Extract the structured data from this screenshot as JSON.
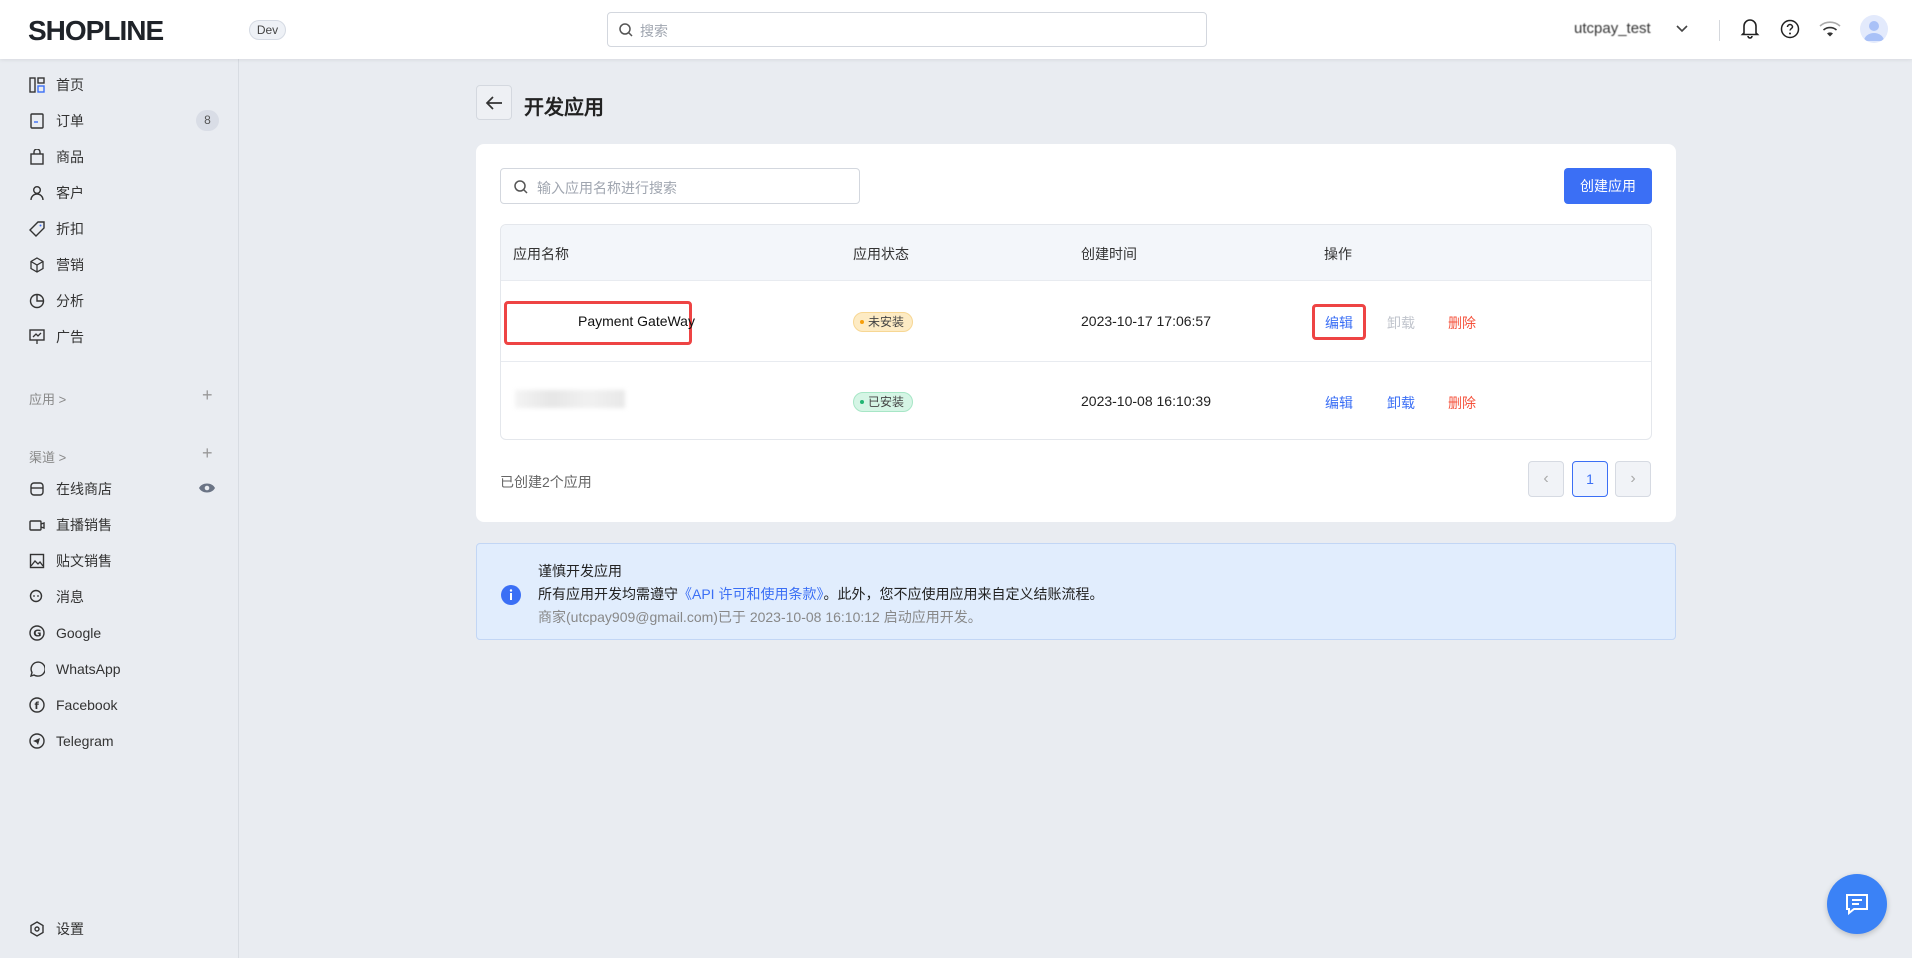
{
  "header": {
    "logo": "SHOPLINE",
    "env_badge": "Dev",
    "search_placeholder": "搜索",
    "username": "utcpay_test"
  },
  "sidebar": {
    "items": [
      {
        "label": "首页",
        "icon": "home-icon"
      },
      {
        "label": "订单",
        "icon": "order-icon",
        "badge": "8"
      },
      {
        "label": "商品",
        "icon": "bag-icon"
      },
      {
        "label": "客户",
        "icon": "user-icon"
      },
      {
        "label": "折扣",
        "icon": "tag-icon"
      },
      {
        "label": "营销",
        "icon": "cube-icon"
      },
      {
        "label": "分析",
        "icon": "pie-icon"
      },
      {
        "label": "广告",
        "icon": "billboard-icon"
      }
    ],
    "apps_section": "应用 >",
    "channels_section": "渠道 >",
    "channels": [
      {
        "label": "在线商店",
        "icon": "store-icon"
      },
      {
        "label": "直播销售",
        "icon": "video-icon"
      },
      {
        "label": "贴文销售",
        "icon": "image-icon"
      },
      {
        "label": "消息",
        "icon": "chat-icon"
      },
      {
        "label": "Google",
        "icon": "google-icon"
      },
      {
        "label": "WhatsApp",
        "icon": "whatsapp-icon"
      },
      {
        "label": "Facebook",
        "icon": "facebook-icon"
      },
      {
        "label": "Telegram",
        "icon": "telegram-icon"
      }
    ],
    "settings": "设置"
  },
  "page": {
    "title": "开发应用",
    "search_placeholder": "输入应用名称进行搜索",
    "create_button": "创建应用",
    "columns": [
      "应用名称",
      "应用状态",
      "创建时间",
      "操作"
    ],
    "rows": [
      {
        "name": "Payment GateWay",
        "status": "未安装",
        "created": "2023-10-17 17:06:57",
        "actions": [
          "编辑",
          "卸载",
          "删除"
        ]
      },
      {
        "name": "",
        "status": "已安装",
        "created": "2023-10-08 16:10:39",
        "actions": [
          "编辑",
          "卸载",
          "删除"
        ]
      }
    ],
    "count_text": "已创建2个应用",
    "pagination": {
      "current": "1"
    }
  },
  "notice": {
    "title": "谨慎开发应用",
    "line_prefix": "所有应用开发均需遵守",
    "link": "《API 许可和使用条款》",
    "line_suffix": "。此外，您不应使用应用来自定义结账流程。",
    "meta": "商家(utcpay909@gmail.com)已于 2023-10-08 16:10:12 启动应用开发。"
  },
  "colors": {
    "primary": "#3b6ff5",
    "danger": "#f5533d",
    "highlight": "#ee4444"
  }
}
